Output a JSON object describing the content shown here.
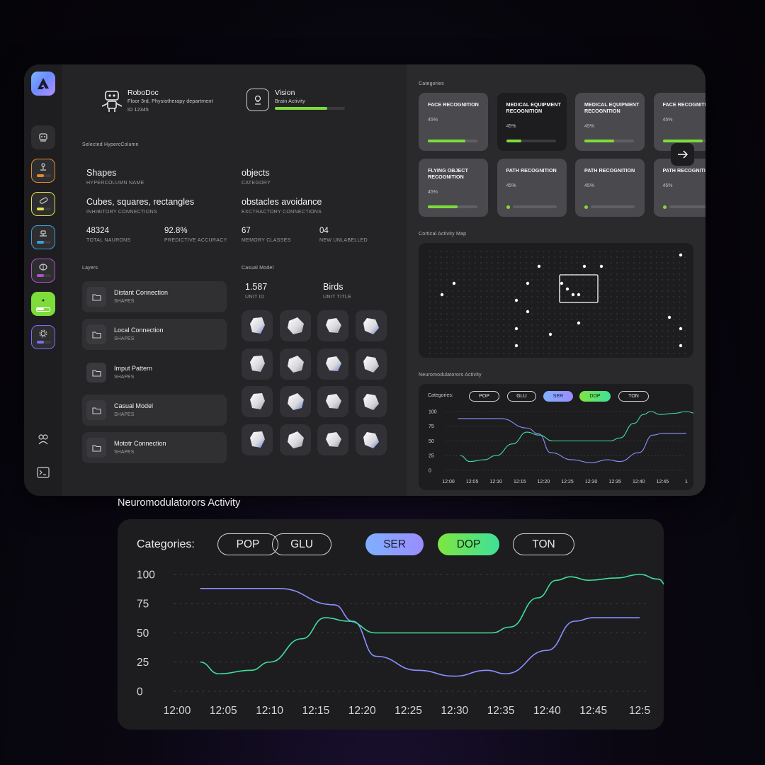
{
  "robot": {
    "name": "RoboDoc",
    "location": "Floor 3rd, Physiotherapy department",
    "id": "ID 12345"
  },
  "vision": {
    "title": "Vision",
    "subtitle": "Brain Activity",
    "progress": 0.75
  },
  "selected": {
    "heading": "Selected HypercColumn",
    "fields": [
      {
        "value": "Shapes",
        "label": "HYPERCOLUMN NAME"
      },
      {
        "value": "objects",
        "label": "CATEGORY"
      },
      {
        "value": "Cubes, squares, rectangles",
        "label": "INHIBITORY CONNECTIONS"
      },
      {
        "value": "obstacles avoidance",
        "label": "EXCTRACTORY CONNECTIONS"
      }
    ],
    "stats": [
      {
        "value": "48324",
        "label": "TOTAL NAURONS"
      },
      {
        "value": "92.8%",
        "label": "PREDICTIVE ACCURACY"
      },
      {
        "value": "67",
        "label": "MEMORY CLASSES"
      },
      {
        "value": "04",
        "label": "NEW UNLABELLED"
      }
    ]
  },
  "layers": {
    "heading": "Layers",
    "items": [
      {
        "title": "Distant Connection",
        "sub": "SHAPES"
      },
      {
        "title": "Local Connection",
        "sub": "SHAPES"
      },
      {
        "title": "Imput Pattern",
        "sub": "SHAPES"
      },
      {
        "title": "Casual Model",
        "sub": "SHAPES"
      },
      {
        "title": "Mototr Connection",
        "sub": "SHAPES"
      }
    ]
  },
  "casual_model": {
    "heading": "Casual Model",
    "unit_id": "1.587",
    "unit_id_label": "UNIT ID",
    "unit_title": "Birds",
    "unit_title_label": "UNIT TITLE"
  },
  "categories": {
    "heading": "Categories",
    "cards": [
      {
        "title": "FACE RECOGNITION",
        "percent": "45%",
        "progress": 0.75
      },
      {
        "title": "MEDICAL EQUIPMENT RECOGNITION",
        "percent": "45%",
        "progress": 0.3
      },
      {
        "title": "MEDICAL EQUIPMENT RECOGNITION",
        "percent": "45%",
        "progress": 0.6
      },
      {
        "title": "FACE RECOGNITION",
        "percent": "45%",
        "progress": 0.8
      },
      {
        "title": "FLYING OBJECT RECOGNITION",
        "percent": "45%",
        "progress": 0.6
      },
      {
        "title": "PATH RECOGNITION",
        "percent": "45%",
        "progress": 0.05
      },
      {
        "title": "PATH RECOGNITION",
        "percent": "45%",
        "progress": 0.05
      },
      {
        "title": "PATH RECOGNITION",
        "percent": "45%",
        "progress": 0.05
      }
    ]
  },
  "cortical_map": {
    "heading": "Cortical Activity Map"
  },
  "neuro": {
    "heading": "Neuromodulatorors Activity",
    "categories_label": "Categories:",
    "pills": [
      "POP",
      "GLU",
      "SER",
      "DOP",
      "TON"
    ]
  },
  "colors": {
    "accent_green": "#7ddc3a",
    "ser_blue": "#8a90ff",
    "dop_green": "#3fe09a"
  },
  "chart_data": [
    {
      "type": "line",
      "title": "Neuromodulatorors Activity",
      "x": [
        "12:00",
        "12:05",
        "12:10",
        "12:15",
        "12:20",
        "12:25",
        "12:30",
        "12:35",
        "12:40",
        "12:45",
        "1"
      ],
      "ylim": [
        0,
        100
      ],
      "yticks": [
        100,
        75,
        50,
        25,
        0
      ],
      "series": [
        {
          "name": "SER",
          "color": "#8a90ff",
          "points": [
            [
              0.4,
              88
            ],
            [
              1.2,
              88
            ],
            [
              2.2,
              88
            ],
            [
              3.3,
              72
            ],
            [
              3.8,
              62
            ],
            [
              4.3,
              30
            ],
            [
              5.2,
              18
            ],
            [
              6,
              13
            ],
            [
              6.7,
              18
            ],
            [
              7.2,
              15
            ],
            [
              8,
              30
            ],
            [
              8.6,
              60
            ],
            [
              9,
              63
            ],
            [
              10,
              63
            ]
          ]
        },
        {
          "name": "DOP",
          "color": "#3fe09a",
          "points": [
            [
              0.5,
              25
            ],
            [
              0.9,
              15
            ],
            [
              1.5,
              18
            ],
            [
              2,
              25
            ],
            [
              2.7,
              45
            ],
            [
              3.3,
              65
            ],
            [
              3.8,
              60
            ],
            [
              4.4,
              50
            ],
            [
              5.2,
              50
            ],
            [
              6,
              50
            ],
            [
              6.8,
              50
            ],
            [
              7.2,
              55
            ],
            [
              7.8,
              80
            ],
            [
              8.2,
              95
            ],
            [
              8.5,
              100
            ],
            [
              8.9,
              95
            ],
            [
              9.5,
              97
            ],
            [
              10,
              100
            ],
            [
              10.4,
              97
            ],
            [
              10.6,
              90
            ]
          ]
        }
      ]
    },
    {
      "type": "line",
      "title": "Neuromodulatorors Activity",
      "x": [
        "12:00",
        "12:05",
        "12:10",
        "12:15",
        "12:20",
        "12:25",
        "12:30",
        "12:35",
        "12:40",
        "12:45",
        "12:5"
      ],
      "ylim": [
        0,
        100
      ],
      "yticks": [
        100,
        75,
        50,
        25,
        0
      ],
      "series": [
        {
          "name": "SER",
          "color": "#8a90ff",
          "points": [
            [
              0.5,
              88
            ],
            [
              1.2,
              88
            ],
            [
              2.2,
              88
            ],
            [
              3.4,
              74
            ],
            [
              3.8,
              60
            ],
            [
              4.3,
              30
            ],
            [
              5.2,
              18
            ],
            [
              6,
              13
            ],
            [
              6.7,
              18
            ],
            [
              7.1,
              15
            ],
            [
              8,
              35
            ],
            [
              8.6,
              60
            ],
            [
              9,
              63
            ],
            [
              10,
              63
            ]
          ]
        },
        {
          "name": "DOP",
          "color": "#3fe09a",
          "points": [
            [
              0.5,
              25
            ],
            [
              0.9,
              15
            ],
            [
              1.6,
              18
            ],
            [
              2,
              25
            ],
            [
              2.7,
              45
            ],
            [
              3.2,
              63
            ],
            [
              3.7,
              60
            ],
            [
              4.3,
              50
            ],
            [
              5.2,
              50
            ],
            [
              6,
              50
            ],
            [
              6.8,
              50
            ],
            [
              7.2,
              55
            ],
            [
              7.8,
              80
            ],
            [
              8.2,
              95
            ],
            [
              8.5,
              98
            ],
            [
              8.9,
              95
            ],
            [
              9.5,
              97
            ],
            [
              10,
              100
            ],
            [
              10.4,
              96
            ],
            [
              10.6,
              90
            ]
          ]
        }
      ]
    }
  ]
}
